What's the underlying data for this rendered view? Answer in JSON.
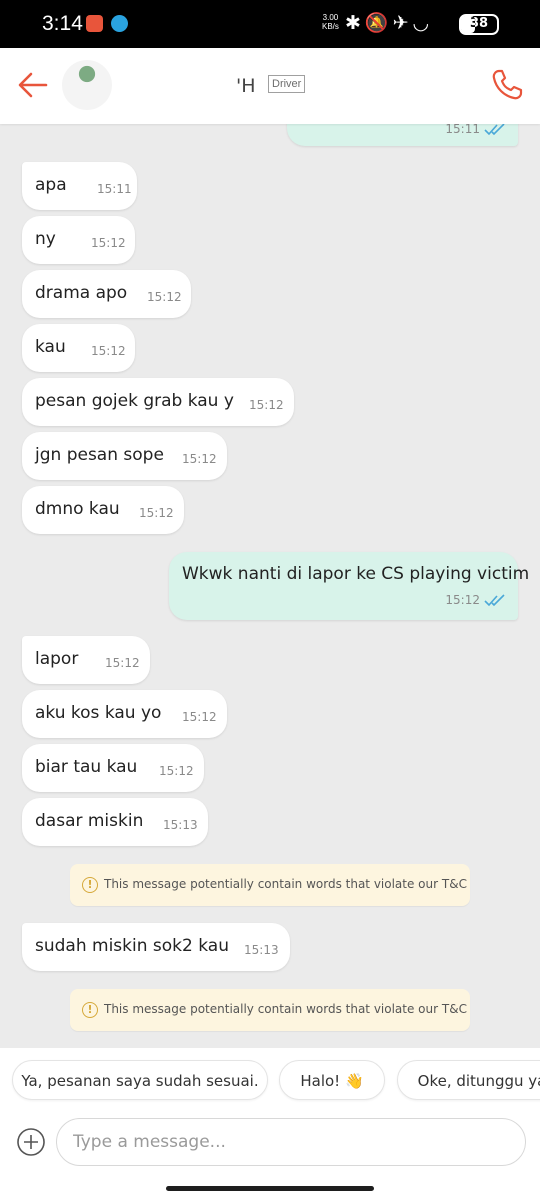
{
  "status_bar": {
    "time": "3:14",
    "net_speed_value": "3.00",
    "net_speed_unit": "KB/s",
    "battery": "38",
    "icons": [
      "app-notification-icon",
      "telegram-icon",
      "bluetooth-icon",
      "mute-icon",
      "airplane-icon",
      "wifi-icon",
      "battery-icon"
    ]
  },
  "header": {
    "contact_name": "'H",
    "badge": "Driver",
    "colors": {
      "accent": "#e8553b"
    }
  },
  "chat": {
    "top_partial": {
      "time": "15:11"
    },
    "messages_a": [
      {
        "text": "apa",
        "time": "15:11"
      },
      {
        "text": "ny",
        "time": "15:12"
      },
      {
        "text": "drama apo",
        "time": "15:12"
      },
      {
        "text": "kau",
        "time": "15:12"
      },
      {
        "text": "pesan gojek grab kau y",
        "time": "15:12"
      },
      {
        "text": "jgn pesan sope",
        "time": "15:12"
      },
      {
        "text": "dmno kau",
        "time": "15:12"
      }
    ],
    "outgoing": {
      "text": "Wkwk nanti di lapor ke CS playing victim",
      "time": "15:12"
    },
    "messages_b": [
      {
        "text": "lapor",
        "time": "15:12"
      },
      {
        "text": "aku kos kau yo",
        "time": "15:12"
      },
      {
        "text": "biar tau kau",
        "time": "15:12"
      },
      {
        "text": "dasar miskin",
        "time": "15:13"
      }
    ],
    "warning_text": "This message potentially contain words that violate our T&C",
    "message_c": {
      "text": "sudah miskin sok2 kau",
      "time": "15:13"
    },
    "colors": {
      "outgoing_bubble": "#d8f3ea",
      "incoming_bubble": "#ffffff",
      "warning_bg": "#fdf5df",
      "ticks": "#4aa8d8"
    }
  },
  "quick_replies": [
    "Ya, pesanan saya sudah sesuai.",
    "Halo! 👋",
    "Oke, ditunggu ya"
  ],
  "input": {
    "placeholder": "Type a message..."
  }
}
